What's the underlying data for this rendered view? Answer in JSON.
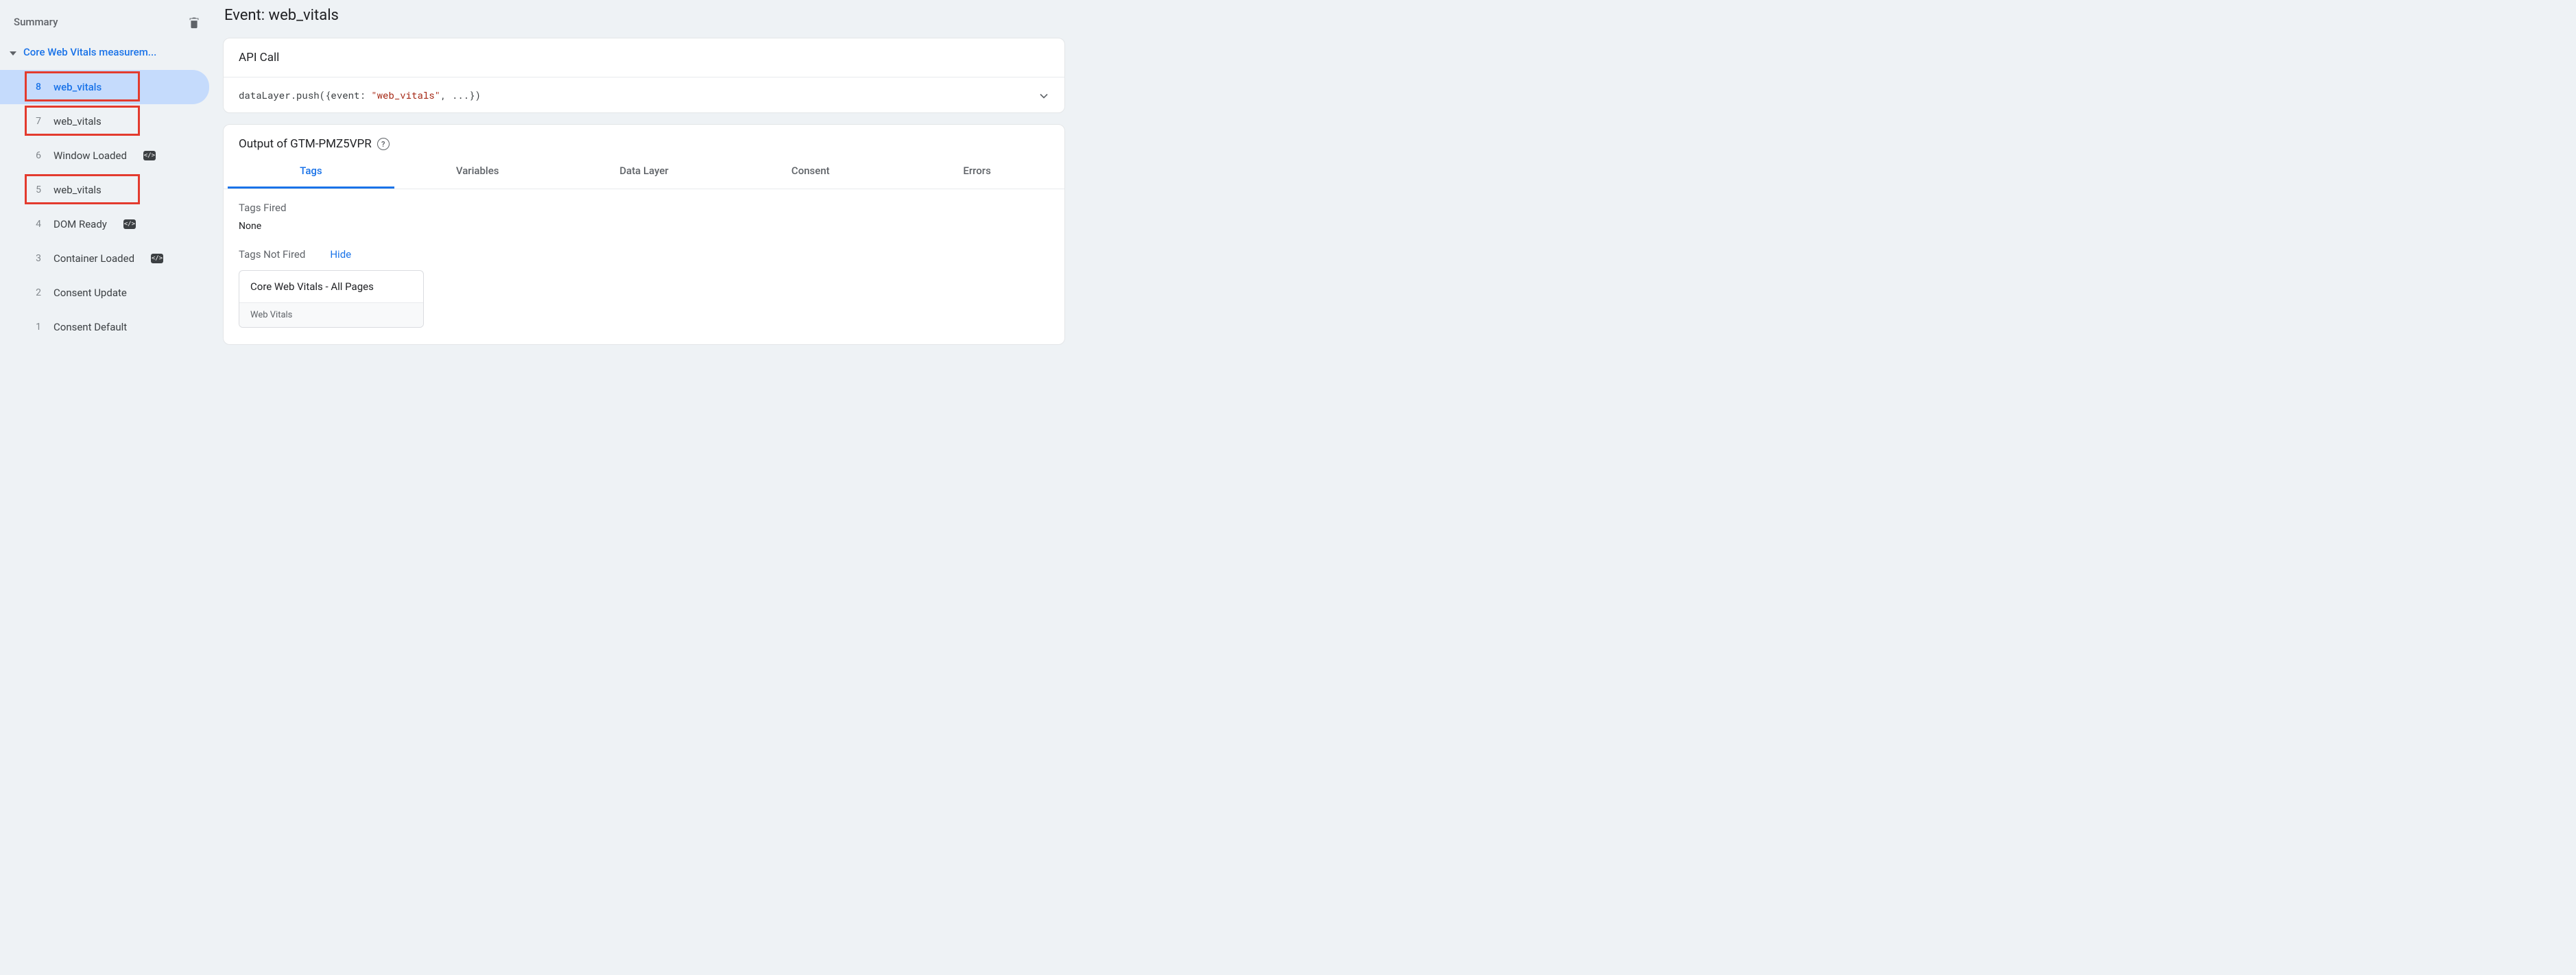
{
  "sidebar": {
    "summary_label": "Summary",
    "group_label": "Core Web Vitals measurem...",
    "events": [
      {
        "num": "8",
        "name": "web_vitals",
        "active": true,
        "badge": null,
        "highlight": true
      },
      {
        "num": "7",
        "name": "web_vitals",
        "active": false,
        "badge": null,
        "highlight": true
      },
      {
        "num": "6",
        "name": "Window Loaded",
        "active": false,
        "badge": "</>",
        "highlight": false
      },
      {
        "num": "5",
        "name": "web_vitals",
        "active": false,
        "badge": null,
        "highlight": true
      },
      {
        "num": "4",
        "name": "DOM Ready",
        "active": false,
        "badge": "</>",
        "highlight": false
      },
      {
        "num": "3",
        "name": "Container Loaded",
        "active": false,
        "badge": "</>",
        "highlight": false
      },
      {
        "num": "2",
        "name": "Consent Update",
        "active": false,
        "badge": null,
        "highlight": false
      },
      {
        "num": "1",
        "name": "Consent Default",
        "active": false,
        "badge": null,
        "highlight": false
      }
    ]
  },
  "main": {
    "title_prefix": "Event: ",
    "title_event": "web_vitals",
    "api_card": {
      "header": "API Call",
      "code_prefix": "dataLayer.push({event: ",
      "code_string": "\"web_vitals\"",
      "code_suffix": ", ...})"
    },
    "output_card": {
      "title_prefix": "Output of ",
      "container_id": "GTM-PMZ5VPR",
      "tabs": [
        "Tags",
        "Variables",
        "Data Layer",
        "Consent",
        "Errors"
      ],
      "active_tab": 0,
      "tags_fired_label": "Tags Fired",
      "tags_fired_value": "None",
      "tags_not_fired_label": "Tags Not Fired",
      "hide_label": "Hide",
      "not_fired_tag": {
        "title": "Core Web Vitals - All Pages",
        "subtitle": "Web Vitals"
      }
    }
  }
}
